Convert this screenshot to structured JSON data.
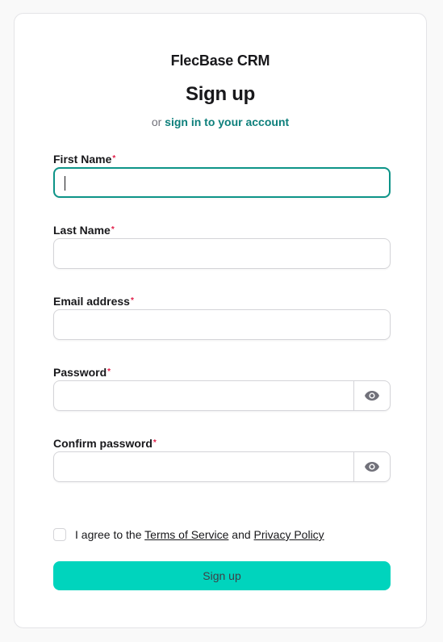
{
  "brand": "FlecBase CRM",
  "heading": "Sign up",
  "subline": {
    "prefix": "or",
    "link": "sign in to your account"
  },
  "required_mark": "*",
  "fields": {
    "first_name": {
      "label": "First Name",
      "value": "",
      "focused": true
    },
    "last_name": {
      "label": "Last Name",
      "value": ""
    },
    "email": {
      "label": "Email address",
      "value": ""
    },
    "password": {
      "label": "Password",
      "value": "",
      "toggle_icon": "eye-icon"
    },
    "confirm_password": {
      "label": "Confirm password",
      "value": "",
      "toggle_icon": "eye-icon"
    }
  },
  "agreement": {
    "checked": false,
    "prefix": "I agree to the",
    "terms": "Terms of Service",
    "conjunction": "and",
    "privacy": "Privacy Policy"
  },
  "submit_label": "Sign up",
  "colors": {
    "accent": "#00d4bd",
    "link": "#0d7f7b",
    "focus_ring": "#0d9488",
    "required": "#e11d48"
  }
}
